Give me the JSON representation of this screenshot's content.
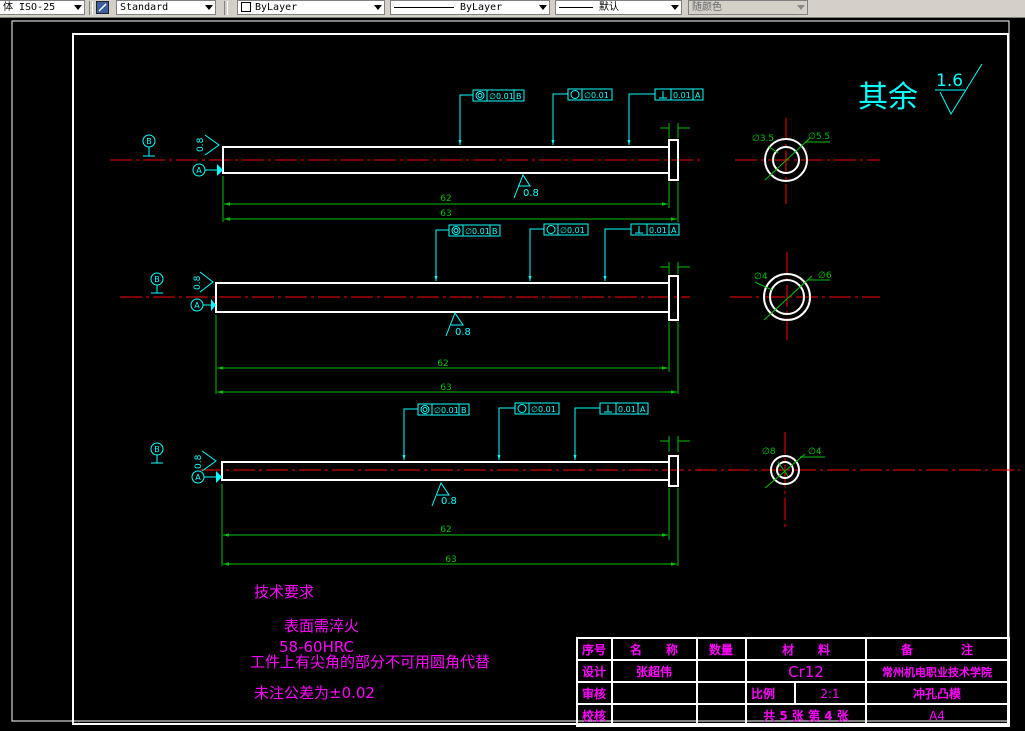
{
  "toolbar": {
    "dimstyle": "体 ISO-25",
    "textstyle": "Standard",
    "layer": "ByLayer",
    "linetype": "ByLayer",
    "lineweight": "默认",
    "plotstyle": "随颜色"
  },
  "roughness_note": {
    "label": "其余",
    "value": "1.6"
  },
  "colors": {
    "outline": "#ffffff",
    "dimension": "#00c000",
    "annotation": "#00ffff",
    "centerline": "#ff0000",
    "notes": "#ff00ff",
    "background": "#000000"
  },
  "pins": [
    {
      "datum_b": "B",
      "datum_a": "A",
      "end_roughness": "0.8",
      "surface_roughness": "0.8",
      "gtol": [
        {
          "symbol": "concentricity",
          "tolerance": "∅0.01",
          "datum": "B"
        },
        {
          "symbol": "circularity",
          "tolerance": "∅0.01",
          "datum": ""
        },
        {
          "symbol": "perpendicularity",
          "tolerance": "0.01",
          "datum": "A"
        }
      ],
      "dim_shaft": "62",
      "dim_total": "63",
      "hole_dia": "∅3.5",
      "outer_dia": "∅5.5"
    },
    {
      "datum_b": "B",
      "datum_a": "A",
      "end_roughness": "0.8",
      "surface_roughness": "0.8",
      "gtol": [
        {
          "symbol": "concentricity",
          "tolerance": "∅0.01",
          "datum": "B"
        },
        {
          "symbol": "circularity",
          "tolerance": "∅0.01",
          "datum": ""
        },
        {
          "symbol": "perpendicularity",
          "tolerance": "0.01",
          "datum": "A"
        }
      ],
      "dim_shaft": "62",
      "dim_total": "63",
      "hole_dia": "∅4",
      "outer_dia": "∅6"
    },
    {
      "datum_b": "B",
      "datum_a": "A",
      "end_roughness": "0.8",
      "surface_roughness": "0.8",
      "gtol": [
        {
          "symbol": "concentricity",
          "tolerance": "∅0.01",
          "datum": "B"
        },
        {
          "symbol": "circularity",
          "tolerance": "∅0.01",
          "datum": ""
        },
        {
          "symbol": "perpendicularity",
          "tolerance": "0.01",
          "datum": "A"
        }
      ],
      "dim_shaft": "62",
      "dim_total": "63",
      "hole_dia": "∅8",
      "outer_dia": "∅4"
    }
  ],
  "tech_requirements": {
    "title": "技术要求",
    "lines": [
      "表面需淬火",
      "58-60HRC",
      "工件上有尖角的部分不可用圆角代替",
      "未注公差为±0.02"
    ]
  },
  "title_block": {
    "header": {
      "seq": "序号",
      "name": "名　　称",
      "qty": "数量",
      "material": "材　　料",
      "remark": "备　　　　注"
    },
    "designer_label": "设计",
    "designer": "张超伟",
    "material": "Cr12",
    "school": "常州机电职业技术学院",
    "review_label": "审核",
    "scale_label": "比例",
    "scale": "2:1",
    "part_name": "冲孔凸模",
    "check_label": "校核",
    "sheets": "共 5 张 第 4 张",
    "paper": "A4"
  }
}
